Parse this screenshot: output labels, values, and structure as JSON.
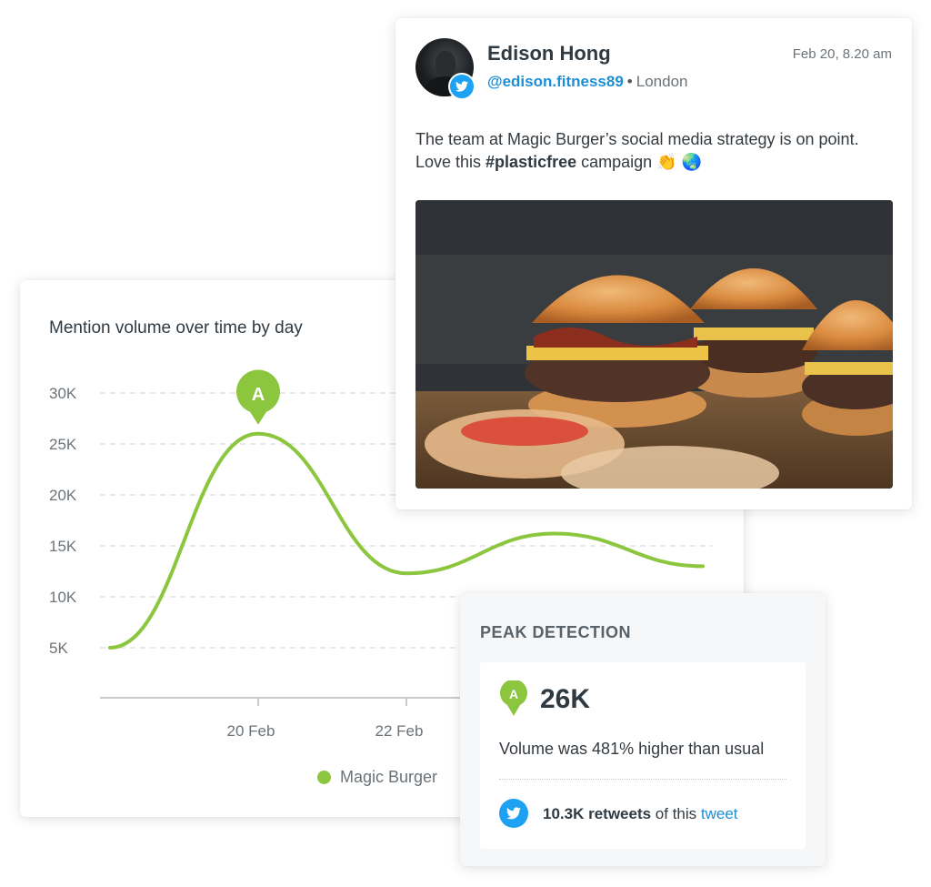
{
  "colors": {
    "accent_green": "#8cc63f",
    "twitter_blue": "#1da1f2",
    "link_blue": "#1b8fd6",
    "grid": "#d9dcde"
  },
  "chart_panel": {
    "title": "Mention volume over time by day",
    "legend_label": "Magic Burger",
    "peak_marker_label": "A"
  },
  "chart_data": {
    "type": "line",
    "title": "Mention volume over time by day",
    "xlabel": "",
    "ylabel": "",
    "y_ticks": [
      "5K",
      "10K",
      "15K",
      "20K",
      "25K",
      "30K"
    ],
    "y_tick_values": [
      5000,
      10000,
      15000,
      20000,
      25000,
      30000
    ],
    "ylim": [
      0,
      30000
    ],
    "x_ticks": [
      "20 Feb",
      "22 Feb"
    ],
    "grid": true,
    "legend_position": "bottom",
    "series": [
      {
        "name": "Magic Burger",
        "color": "#8cc63f",
        "points": [
          {
            "x": 18.0,
            "y": 5000
          },
          {
            "x": 20.0,
            "y": 26000
          },
          {
            "x": 22.0,
            "y": 12300
          },
          {
            "x": 24.0,
            "y": 16200
          },
          {
            "x": 26.0,
            "y": 13000
          }
        ]
      }
    ],
    "annotations": [
      {
        "label": "A",
        "x": 20.0,
        "y": 26000
      }
    ]
  },
  "tweet": {
    "author_name": "Edison Hong",
    "handle": "@edison.fitness89",
    "separator": "•",
    "location": "London",
    "date": "Feb 20, 8.20 am",
    "text_before": "The team at Magic Burger’s social media strategy is on point.",
    "text_love": "Love this ",
    "hashtag": "#plasticfree",
    "text_after": " campaign 👏 🌏",
    "photo_icon": "burger-photo"
  },
  "peak_detection": {
    "heading": "PEAK DETECTION",
    "marker_label": "A",
    "value": "26K",
    "description": "Volume was 481% higher than usual",
    "retweet_count": "10.3K retweets",
    "retweet_middle": " of this ",
    "retweet_link": "tweet"
  }
}
